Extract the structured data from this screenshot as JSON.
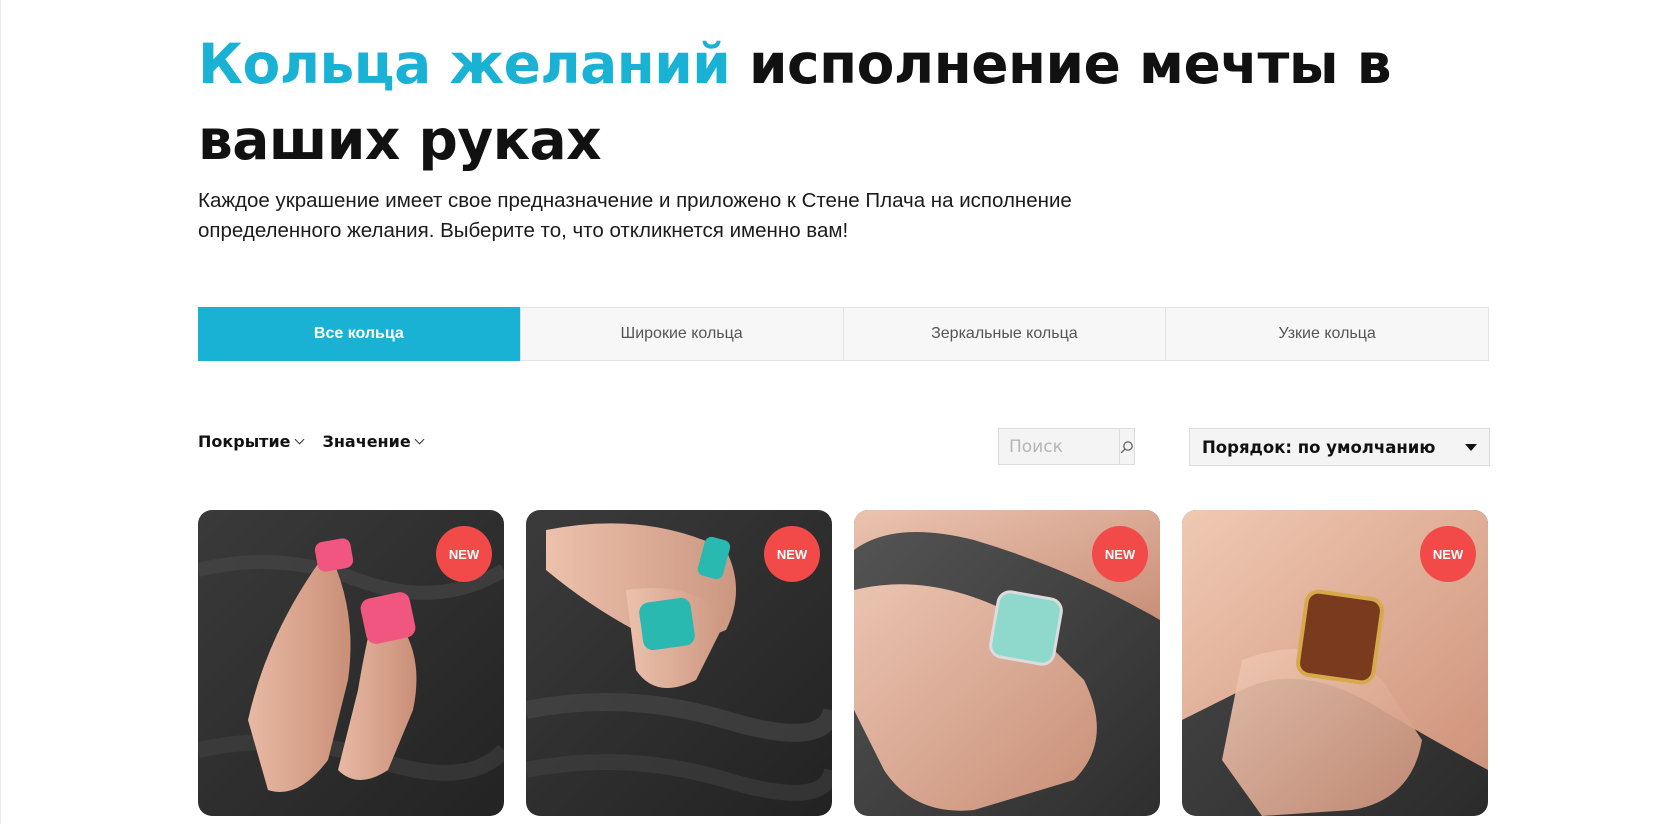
{
  "hero": {
    "title_accent": "Кольца желаний",
    "title_rest": " исполнение мечты в ваших руках",
    "subtitle": "Каждое украшение имеет свое предназначение и приложено к Стене Плача на исполнение определенного желания. Выберите то, что откликнется именно вам!"
  },
  "tabs": [
    {
      "label": "Все кольца",
      "active": true
    },
    {
      "label": "Широкие кольца",
      "active": false
    },
    {
      "label": "Зеркальные кольца",
      "active": false
    },
    {
      "label": "Узкие кольца",
      "active": false
    }
  ],
  "filters": {
    "coating": "Покрытие",
    "meaning": "Значение"
  },
  "search": {
    "placeholder": "Поиск",
    "icon": "search-icon"
  },
  "sort": {
    "label": "Порядок: по умолчанию",
    "icon": "caret-down-icon"
  },
  "colors": {
    "accent": "#1ab2d4",
    "badge": "#f24949"
  },
  "products": [
    {
      "badge": "NEW",
      "ring_color": "#f0567f"
    },
    {
      "badge": "NEW",
      "ring_color": "#2ab9b0"
    },
    {
      "badge": "NEW",
      "ring_color": "#8fd9cc"
    },
    {
      "badge": "NEW",
      "ring_color": "#7a3a1e"
    }
  ]
}
